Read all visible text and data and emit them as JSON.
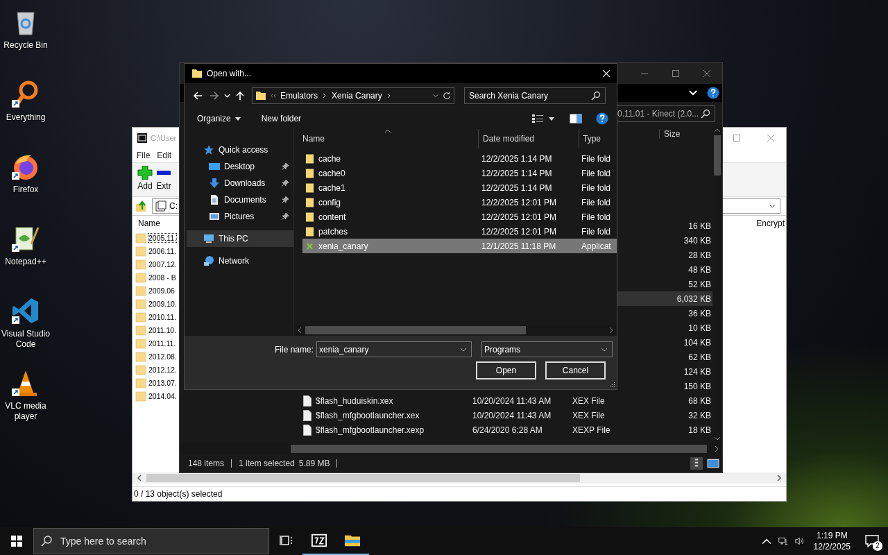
{
  "desktop_icons": [
    {
      "label": "Recycle Bin",
      "kind": "recycle-bin",
      "shortcut": false
    },
    {
      "label": "Everything",
      "kind": "everything",
      "shortcut": true
    },
    {
      "label": "Firefox",
      "kind": "firefox",
      "shortcut": true
    },
    {
      "label": "Notepad++",
      "kind": "notepad",
      "shortcut": true
    },
    {
      "label": "Visual Studio Code",
      "kind": "vscode",
      "shortcut": true
    },
    {
      "label": "VLC media player",
      "kind": "vlc",
      "shortcut": true
    }
  ],
  "archive_window": {
    "title": "C:\\User",
    "menu": [
      "File",
      "Edit"
    ],
    "toolbar": [
      {
        "label": "Add",
        "kind": "add"
      },
      {
        "label": "Extr",
        "kind": "extract"
      }
    ],
    "address": "C:",
    "columns": [
      "Name",
      "Encrypt"
    ],
    "rows": [
      {
        "name": "2005.11.",
        "focused": true
      },
      {
        "name": "2006.11.",
        "focused": false
      },
      {
        "name": "2007.12.",
        "focused": false
      },
      {
        "name": "2008 - B",
        "focused": false
      },
      {
        "name": "2009.06",
        "focused": false
      },
      {
        "name": "2009.10.",
        "focused": false
      },
      {
        "name": "2010.11.",
        "focused": false
      },
      {
        "name": "2011.10.",
        "focused": false
      },
      {
        "name": "2011.11.",
        "focused": false
      },
      {
        "name": "2012.08.",
        "focused": false
      },
      {
        "name": "2012.12.",
        "focused": false
      },
      {
        "name": "2013.07.",
        "focused": false
      },
      {
        "name": "2014.04.",
        "focused": false
      }
    ],
    "status": "0 / 13 object(s) selected"
  },
  "explorer_window": {
    "search": {
      "placeholder": "0.11.01 - Kinect (2.0..."
    },
    "columns": [
      "Size"
    ],
    "rows": [
      {
        "size": "16 KB",
        "selected": false
      },
      {
        "size": "340 KB",
        "selected": false
      },
      {
        "size": "28 KB",
        "selected": false
      },
      {
        "size": "48 KB",
        "selected": false
      },
      {
        "size": "52 KB",
        "selected": false
      },
      {
        "size": "6,032 KB",
        "selected": true
      },
      {
        "size": "36 KB",
        "selected": false
      },
      {
        "size": "10 KB",
        "selected": false
      },
      {
        "size": "104 KB",
        "selected": false
      },
      {
        "size": "62 KB",
        "selected": false
      },
      {
        "size": "124 KB",
        "selected": false
      },
      {
        "size": "150 KB",
        "selected": false
      },
      {
        "name": "$flash_huduiskin.xex",
        "date": "10/20/2024 11:43 AM",
        "type": "XEX File",
        "size": "68 KB",
        "selected": false
      },
      {
        "name": "$flash_mfgbootlauncher.xex",
        "date": "10/20/2024 11:43 AM",
        "type": "XEX File",
        "size": "32 KB",
        "selected": false
      },
      {
        "name": "$flash_mfgbootlauncher.xexp",
        "date": "6/24/2020 6:28 AM",
        "type": "XEXP File",
        "size": "18 KB",
        "selected": false
      }
    ],
    "status": {
      "item_count": "148 items",
      "selection": "1 item selected",
      "selection_size": "5.89 MB"
    }
  },
  "dialog": {
    "title": "Open with...",
    "breadcrumb": [
      "Emulators",
      "Xenia Canary"
    ],
    "search": {
      "placeholder": "Search Xenia Canary"
    },
    "commands": [
      {
        "label": "Organize",
        "dropdown": true
      },
      {
        "label": "New folder",
        "dropdown": false
      }
    ],
    "nav": [
      {
        "label": "Quick access",
        "kind": "star",
        "selected": false,
        "children": [
          {
            "label": "Desktop",
            "kind": "desktop",
            "pinned": true,
            "selected": false
          },
          {
            "label": "Downloads",
            "kind": "downloads",
            "pinned": true,
            "selected": false
          },
          {
            "label": "Documents",
            "kind": "documents",
            "pinned": true,
            "selected": false
          },
          {
            "label": "Pictures",
            "kind": "pictures",
            "pinned": true,
            "selected": false
          }
        ]
      },
      {
        "label": "This PC",
        "kind": "pc",
        "selected": true
      },
      {
        "label": "Network",
        "kind": "network",
        "selected": false
      }
    ],
    "columns": [
      "Name",
      "Date modified",
      "Type"
    ],
    "rows": [
      {
        "name": "cache",
        "date": "12/2/2025 1:14 PM",
        "type": "File fold",
        "kind": "folder",
        "selected": false
      },
      {
        "name": "cache0",
        "date": "12/2/2025 1:14 PM",
        "type": "File fold",
        "kind": "folder",
        "selected": false
      },
      {
        "name": "cache1",
        "date": "12/2/2025 1:14 PM",
        "type": "File fold",
        "kind": "folder",
        "selected": false
      },
      {
        "name": "config",
        "date": "12/2/2025 12:01 PM",
        "type": "File fold",
        "kind": "folder",
        "selected": false
      },
      {
        "name": "content",
        "date": "12/2/2025 12:01 PM",
        "type": "File fold",
        "kind": "folder",
        "selected": false
      },
      {
        "name": "patches",
        "date": "12/2/2025 12:01 PM",
        "type": "File fold",
        "kind": "folder",
        "selected": false
      },
      {
        "name": "xenia_canary",
        "date": "12/1/2025 11:18 PM",
        "type": "Applicat",
        "kind": "app",
        "selected": true
      }
    ],
    "file_name_label": "File name:",
    "file_name": "xenia_canary",
    "filter": "Programs",
    "buttons": [
      "Open",
      "Cancel"
    ]
  },
  "taskbar": {
    "search_placeholder": "Type here to search",
    "apps": [
      {
        "kind": "task-view",
        "running": false
      },
      {
        "kind": "archiver",
        "running": true
      },
      {
        "kind": "explorer",
        "running": true
      }
    ],
    "time": "1:19 PM",
    "date": "12/2/2025",
    "notification_count": "2"
  }
}
